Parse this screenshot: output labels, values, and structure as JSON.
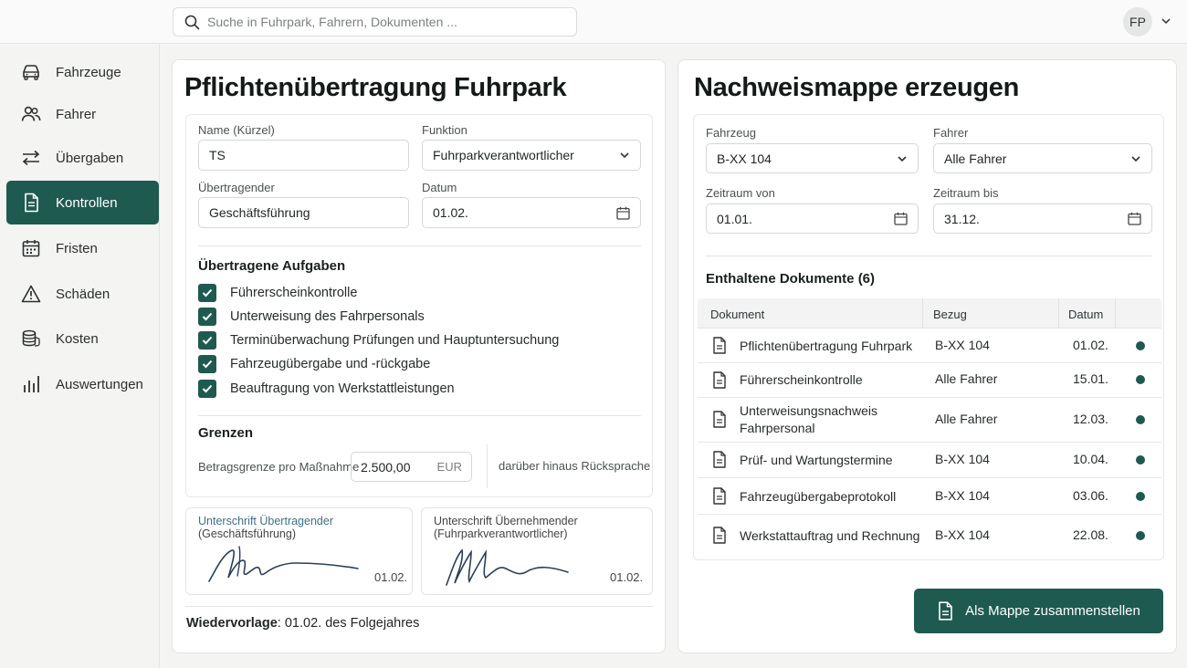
{
  "header": {
    "search_placeholder": "Suche in Fuhrpark, Fahrern, Dokumenten ...",
    "user_initials": "FP"
  },
  "sidebar": {
    "items": [
      {
        "label": "Fahrzeuge",
        "icon": "car-icon"
      },
      {
        "label": "Fahrer",
        "icon": "users-icon"
      },
      {
        "label": "Übergaben",
        "icon": "arrows-swap-icon"
      },
      {
        "label": "Kontrollen",
        "icon": "document-icon",
        "active": true
      },
      {
        "label": "Fristen",
        "icon": "calendar-icon"
      },
      {
        "label": "Schäden",
        "icon": "warning-icon"
      },
      {
        "label": "Kosten",
        "icon": "coins-icon"
      },
      {
        "label": "Auswertungen",
        "icon": "bar-chart-icon"
      }
    ]
  },
  "left": {
    "title": "Pflichtenübertragung Fuhrpark",
    "name_label": "Name (Kürzel)",
    "name_value": "TS",
    "funktion_label": "Funktion",
    "funktion_value": "Fuhrparkverantwortlicher",
    "uebertragender_label": "Übertragender",
    "uebertragender_value": "Geschäftsführung",
    "datum_label": "Datum",
    "datum_value": "01.02.",
    "tasks_title": "Übertragene Aufgaben",
    "tasks": [
      "Führerscheinkontrolle",
      "Unterweisung des Fahrpersonals",
      "Terminüberwachung Prüfungen und Hauptuntersuchung",
      "Fahrzeugübergabe und -rückgabe",
      "Beauftragung von Werkstattleistungen"
    ],
    "grenzen_title": "Grenzen",
    "betrag_label": "Betragsgrenze pro Maßnahme",
    "betrag_value": "2.500,00",
    "betrag_currency": "EUR",
    "betrag_note": "darüber hinaus Rücksprache",
    "sig1_title": "Unterschrift Übertragender",
    "sig1_role": "(Geschäftsführung)",
    "sig1_date": "01.02.",
    "sig2_title": "Unterschrift Übernehmender",
    "sig2_role": "(Fuhrparkverantwortlicher)",
    "sig2_date": "01.02.",
    "wiedervorlage_label": "Wiedervorlage",
    "wiedervorlage_value": ": 01.02. des Folgejahres"
  },
  "right": {
    "title": "Nachweismappe erzeugen",
    "fahrzeug_label": "Fahrzeug",
    "fahrzeug_value": "B-XX 104",
    "fahrer_label": "Fahrer",
    "fahrer_value": "Alle Fahrer",
    "von_label": "Zeitraum von",
    "von_value": "01.01.",
    "bis_label": "Zeitraum bis",
    "bis_value": "31.12.",
    "docs_title": "Enthaltene Dokumente (6)",
    "columns": [
      "Dokument",
      "Bezug",
      "Datum"
    ],
    "rows": [
      {
        "doc": "Pflichtenübertragung Fuhrpark",
        "bezug": "B-XX 104",
        "datum": "01.02."
      },
      {
        "doc": "Führerscheinkontrolle",
        "bezug": "Alle Fahrer",
        "datum": "15.01."
      },
      {
        "doc": "Unterweisungsnachweis Fahrpersonal",
        "bezug": "Alle Fahrer",
        "datum": "12.03."
      },
      {
        "doc": "Prüf- und Wartungstermine",
        "bezug": "B-XX 104",
        "datum": "10.04."
      },
      {
        "doc": "Fahrzeugübergabeprotokoll",
        "bezug": "B-XX 104",
        "datum": "03.06."
      },
      {
        "doc": "Werkstattauftrag und Rechnung",
        "bezug": "B-XX 104",
        "datum": "22.08."
      }
    ],
    "button_label": "Als Mappe zusammenstellen",
    "accent_color": "#1f5a50"
  }
}
